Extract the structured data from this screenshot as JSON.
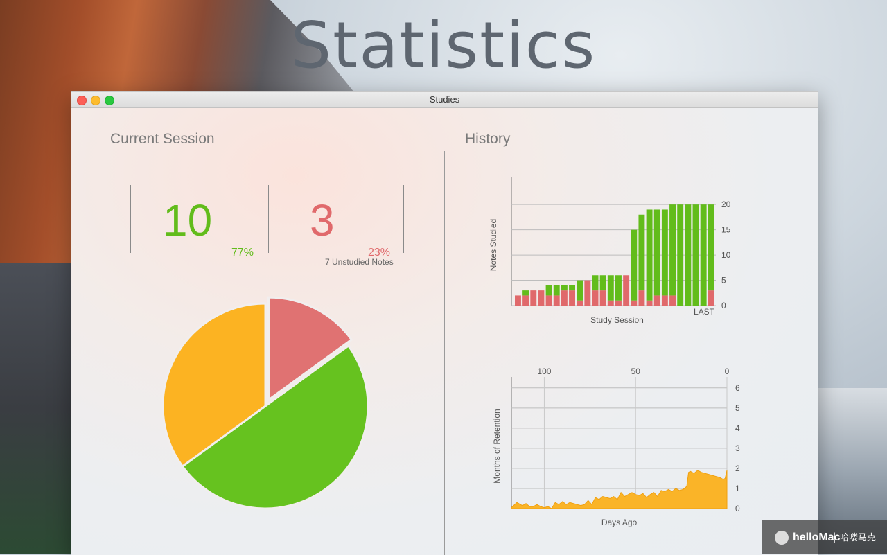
{
  "heading": "Statistics",
  "window": {
    "title": "Studies"
  },
  "current_session": {
    "title": "Current Session",
    "studied_count": "10",
    "studied_pct": "77%",
    "missed_count": "3",
    "missed_pct": "23%",
    "unstudied_note": "7 Unstudied Notes",
    "pie": {
      "studied": 10,
      "missed": 3,
      "unstudied": 7
    }
  },
  "history": {
    "title": "History"
  },
  "chart_data": [
    {
      "type": "bar",
      "stacked": true,
      "xlabel": "Study Session",
      "ylabel": "Notes Studied",
      "ylim": [
        0,
        24
      ],
      "yticks": [
        0,
        5,
        10,
        15,
        20
      ],
      "last_label": "LAST",
      "series": [
        {
          "name": "",
          "color": "#e0696b",
          "values": [
            2,
            2,
            3,
            3,
            2,
            2,
            3,
            3,
            1,
            5,
            3,
            3,
            1,
            1,
            6,
            1,
            3,
            1,
            2,
            2,
            2,
            0,
            0,
            0,
            0,
            3
          ]
        },
        {
          "name": "",
          "color": "#62bc1b",
          "values": [
            0,
            1,
            0,
            0,
            2,
            2,
            1,
            1,
            4,
            0,
            3,
            3,
            5,
            5,
            0,
            14,
            15,
            18,
            17,
            17,
            18,
            20,
            20,
            20,
            20,
            17
          ]
        }
      ]
    },
    {
      "type": "area",
      "xlabel": "Days Ago",
      "ylabel": "Months of Retention",
      "xlim": [
        118,
        0
      ],
      "xticks": [
        100,
        50,
        0
      ],
      "ylim": [
        0,
        6.2
      ],
      "yticks": [
        0,
        1,
        2,
        3,
        4,
        5,
        6
      ],
      "color": "#fab428",
      "x": [
        118,
        115,
        112,
        110,
        108,
        106,
        104,
        102,
        100,
        98,
        96,
        94,
        92,
        90,
        88,
        86,
        84,
        82,
        80,
        78,
        76,
        74,
        72,
        70,
        68,
        66,
        64,
        62,
        60,
        58,
        56,
        54,
        52,
        50,
        48,
        46,
        44,
        42,
        40,
        38,
        36,
        34,
        32,
        30,
        28,
        26,
        24,
        22,
        21,
        20,
        18,
        16,
        14,
        12,
        10,
        8,
        6,
        4,
        2,
        1,
        0
      ],
      "y": [
        0.05,
        0.3,
        0.15,
        0.25,
        0.1,
        0.1,
        0.2,
        0.1,
        0.05,
        0.1,
        0.0,
        0.3,
        0.2,
        0.35,
        0.2,
        0.3,
        0.25,
        0.2,
        0.15,
        0.2,
        0.4,
        0.2,
        0.55,
        0.45,
        0.6,
        0.55,
        0.5,
        0.6,
        0.45,
        0.8,
        0.6,
        0.7,
        0.8,
        0.7,
        0.65,
        0.75,
        0.55,
        0.7,
        0.8,
        0.6,
        0.9,
        0.85,
        0.95,
        0.85,
        1.0,
        0.9,
        0.95,
        1.1,
        1.8,
        1.85,
        1.75,
        1.9,
        1.8,
        1.75,
        1.7,
        1.65,
        1.6,
        1.55,
        1.45,
        1.5,
        1.9
      ]
    }
  ],
  "badge": {
    "brand": "helloMac",
    "sep": "|",
    "cn": "哈喽马克"
  }
}
